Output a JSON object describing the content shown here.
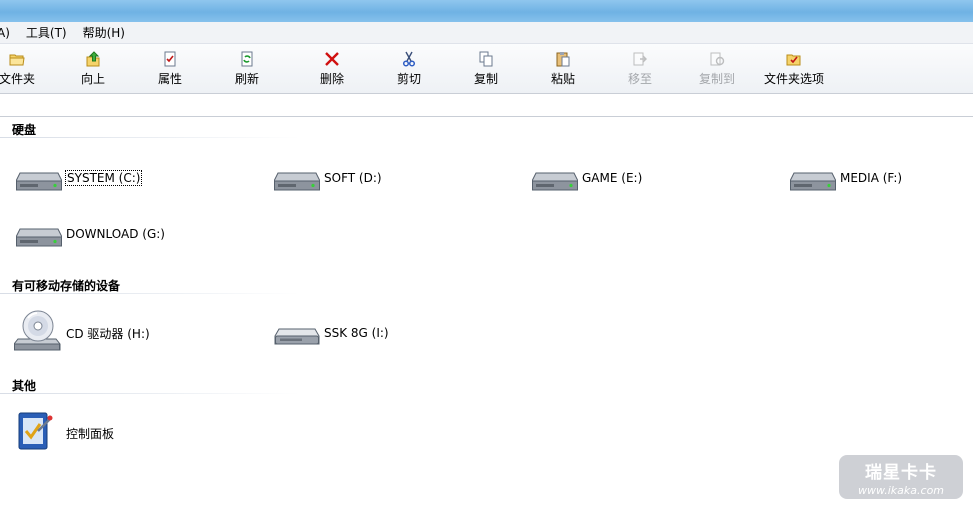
{
  "menu": [
    {
      "label": "A)",
      "name": "menu-view-partial"
    },
    {
      "label": "工具(T)",
      "name": "menu-tools"
    },
    {
      "label": "帮助(H)",
      "name": "menu-help"
    }
  ],
  "toolbar": {
    "folder": "文件夹",
    "up": "向上",
    "properties": "属性",
    "refresh": "刷新",
    "delete": "删除",
    "cut": "剪切",
    "copy": "复制",
    "paste": "粘贴",
    "move_to": "移至",
    "copy_to": "复制到",
    "folder_options": "文件夹选项"
  },
  "groups": {
    "hard_disks": "硬盘",
    "removable": "有可移动存储的设备",
    "other": "其他"
  },
  "drives": {
    "c": "SYSTEM (C:)",
    "d": "SOFT (D:)",
    "e": "GAME (E:)",
    "f": "MEDIA (F:)",
    "g": "DOWNLOAD (G:)",
    "h": "CD 驱动器 (H:)",
    "i": "SSK 8G (I:)"
  },
  "other_items": {
    "control_panel": "控制面板"
  },
  "watermark": {
    "title": "瑞星卡卡",
    "url": "www.ikaka.com"
  },
  "colors": {
    "title_blue": "#78b8e7",
    "toolbar_bg": "#eef1f5",
    "disabled_text": "#a4a7ab",
    "delete_red": "#d01010"
  }
}
